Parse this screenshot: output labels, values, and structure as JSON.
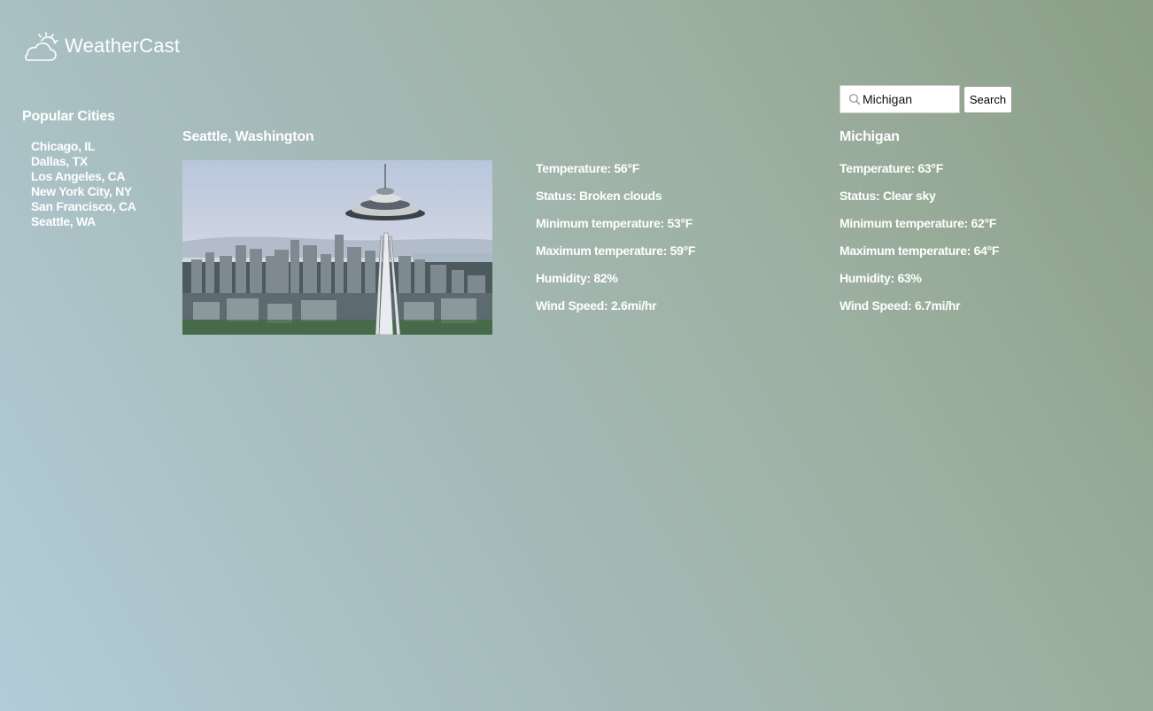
{
  "app": {
    "name": "WeatherCast"
  },
  "sidebar": {
    "title": "Popular Cities",
    "cities": [
      "Chicago, IL",
      "Dallas, TX",
      "Los Angeles, CA",
      "New York City, NY",
      "San Francisco, CA",
      "Seattle, WA"
    ]
  },
  "featured": {
    "city": "Seattle, Washington",
    "image": "space-needle-skyline-photo",
    "details": [
      "Temperature: 56°F",
      "Status: Broken clouds",
      "Minimum temperature: 53°F",
      "Maximum temperature: 59°F",
      "Humidity: 82%",
      "Wind Speed: 2.6mi/hr"
    ]
  },
  "search": {
    "value": "Michigan",
    "button_label": "Search",
    "icon": "search-icon"
  },
  "result": {
    "city": "Michigan",
    "details": [
      "Temperature: 63°F",
      "Status: Clear sky",
      "Minimum temperature: 62°F",
      "Maximum temperature: 64°F",
      "Humidity: 63%",
      "Wind Speed: 6.7mi/hr"
    ]
  },
  "colors": {
    "text": "#ffffff",
    "background_start": "#b2cdd8",
    "background_end": "#8b9e86"
  }
}
